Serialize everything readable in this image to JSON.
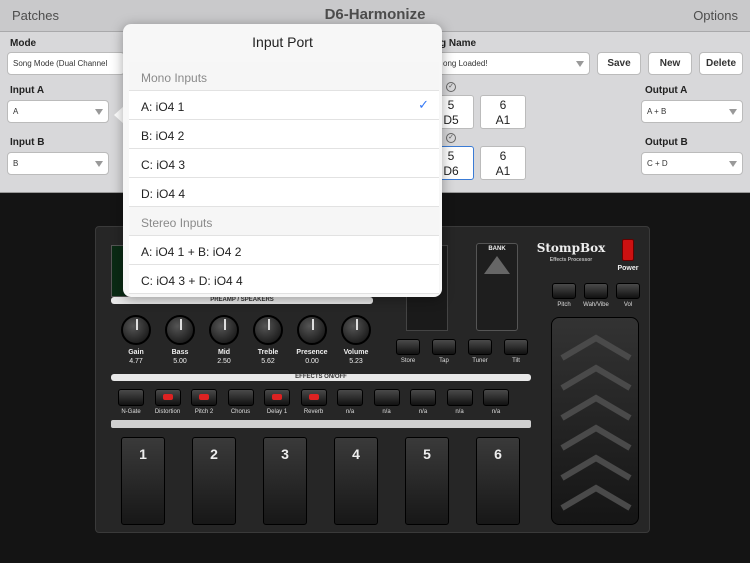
{
  "topbar": {
    "patches": "Patches",
    "title": "D6-Harmonize",
    "options": "Options"
  },
  "panel": {
    "mode_label": "Mode",
    "mode_value": "Song Mode (Dual Channel",
    "song_name_label": "g Name",
    "song_name_value": "ong Loaded!",
    "save": "Save",
    "new": "New",
    "delete": "Delete",
    "input_a_label": "Input A",
    "input_a_value": "A",
    "input_b_label": "Input B",
    "input_b_value": "B",
    "output_a_label": "Output A",
    "output_a_value": "A + B",
    "output_b_label": "Output B",
    "output_b_value": "C + D",
    "patch_boxes": [
      {
        "top": "5",
        "bottom": "D5"
      },
      {
        "top": "6",
        "bottom": "A1"
      },
      {
        "top": "5",
        "bottom": "D6"
      },
      {
        "top": "6",
        "bottom": "A1"
      }
    ]
  },
  "popover": {
    "title": "Input Port",
    "rows": [
      {
        "label": "Mono Inputs",
        "header": true
      },
      {
        "label": "A: iO4 1",
        "checked": true
      },
      {
        "label": "B: iO4 2"
      },
      {
        "label": "C: iO4 3"
      },
      {
        "label": "D: iO4 4"
      },
      {
        "label": "Stereo Inputs",
        "header": true
      },
      {
        "label": "A: iO4 1 + B: iO4 2"
      },
      {
        "label": "C: iO4 3 + D: iO4 4"
      }
    ]
  },
  "rig": {
    "brand": "StompBox",
    "brand_sub": "Effects Processor",
    "power": "Power",
    "bank": "BANK",
    "preamp_label": "PREAMP / SPEAKERS",
    "effects_label": "EFFECTS ON/OFF",
    "knobs": [
      {
        "label": "Gain",
        "value": "4.77"
      },
      {
        "label": "Bass",
        "value": "5.00"
      },
      {
        "label": "Mid",
        "value": "2.50"
      },
      {
        "label": "Treble",
        "value": "5.62"
      },
      {
        "label": "Presence",
        "value": "0.00"
      },
      {
        "label": "Volume",
        "value": "5.23"
      }
    ],
    "small_buttons": [
      "Store",
      "Tap",
      "Tuner",
      "Tilt"
    ],
    "expr_buttons": [
      "Pitch",
      "Wah/Vibe",
      "Vol"
    ],
    "effects": [
      {
        "label": "N-Gate",
        "on": false
      },
      {
        "label": "Distortion",
        "on": true
      },
      {
        "label": "Pitch 2",
        "on": true
      },
      {
        "label": "Chorus",
        "on": false
      },
      {
        "label": "Delay 1",
        "on": true
      },
      {
        "label": "Reverb",
        "on": true
      },
      {
        "label": "n/a",
        "on": false
      },
      {
        "label": "n/a",
        "on": false
      },
      {
        "label": "n/a",
        "on": false
      },
      {
        "label": "n/a",
        "on": false
      },
      {
        "label": "n/a",
        "on": false
      }
    ],
    "pedals": [
      "1",
      "2",
      "3",
      "4",
      "5",
      "6"
    ],
    "active_pedal": "6"
  }
}
